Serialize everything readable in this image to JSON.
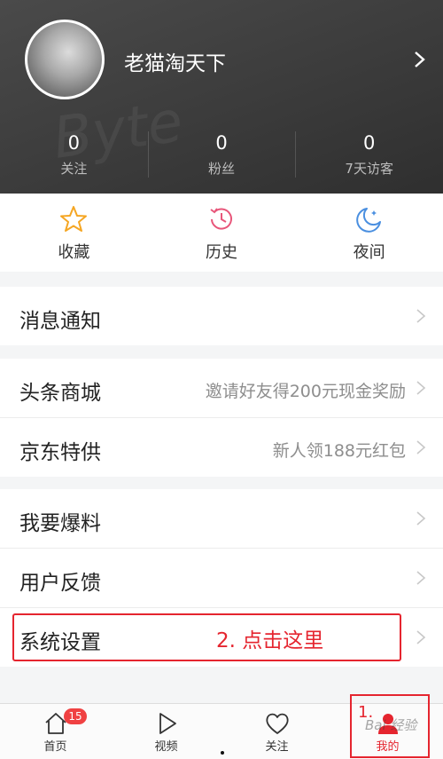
{
  "profile": {
    "username": "老猫淘天下"
  },
  "stats": [
    {
      "value": "0",
      "label": "关注"
    },
    {
      "value": "0",
      "label": "粉丝"
    },
    {
      "value": "0",
      "label": "7天访客"
    }
  ],
  "quick_actions": [
    {
      "label": "收藏",
      "icon": "star-icon"
    },
    {
      "label": "历史",
      "icon": "history-clock-icon"
    },
    {
      "label": "夜间",
      "icon": "moon-icon"
    }
  ],
  "menu": {
    "notifications": "消息通知",
    "mall": {
      "title": "头条商城",
      "sub": "邀请好友得200元现金奖励"
    },
    "jd": {
      "title": "京东特供",
      "sub": "新人领188元红包"
    },
    "tipoff": "我要爆料",
    "feedback": "用户反馈",
    "settings": "系统设置"
  },
  "annotations": {
    "step1": "1.",
    "step2": "2. 点击这里"
  },
  "tabs": [
    {
      "label": "首页",
      "badge": "15",
      "icon": "home-icon"
    },
    {
      "label": "视频",
      "icon": "play-icon"
    },
    {
      "label": "关注",
      "icon": "heart-icon"
    },
    {
      "label": "我的",
      "icon": "user-icon"
    }
  ],
  "watermark": "Bai 经验",
  "colors": {
    "accent": "#e5252f",
    "header_bg": "#3d3d3d",
    "star": "#f5a623",
    "history": "#e8567a",
    "moon": "#4a8fe0"
  }
}
